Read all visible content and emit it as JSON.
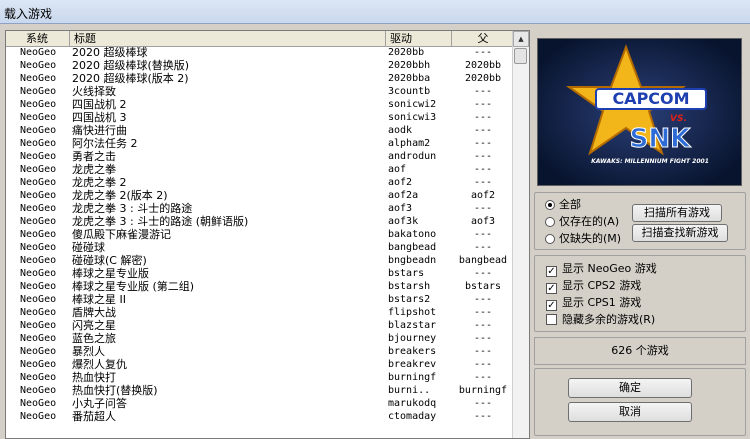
{
  "window": {
    "title": "载入游戏"
  },
  "list": {
    "columns": {
      "system": "系统",
      "title": "标题",
      "driver": "驱动",
      "parent": "父"
    },
    "rows": [
      {
        "system": "NeoGeo",
        "title": "2020 超级棒球",
        "driver": "2020bb",
        "parent": "---"
      },
      {
        "system": "NeoGeo",
        "title": "2020 超级棒球(替换版)",
        "driver": "2020bbh",
        "parent": "2020bb"
      },
      {
        "system": "NeoGeo",
        "title": "2020 超级棒球(版本 2)",
        "driver": "2020bba",
        "parent": "2020bb"
      },
      {
        "system": "NeoGeo",
        "title": "火线择致",
        "driver": "3countb",
        "parent": "---"
      },
      {
        "system": "NeoGeo",
        "title": "四国战机 2",
        "driver": "sonicwi2",
        "parent": "---"
      },
      {
        "system": "NeoGeo",
        "title": "四国战机 3",
        "driver": "sonicwi3",
        "parent": "---"
      },
      {
        "system": "NeoGeo",
        "title": "痛快进行曲",
        "driver": "aodk",
        "parent": "---"
      },
      {
        "system": "NeoGeo",
        "title": "阿尔法任务 2",
        "driver": "alpham2",
        "parent": "---"
      },
      {
        "system": "NeoGeo",
        "title": "勇者之击",
        "driver": "androdun",
        "parent": "---"
      },
      {
        "system": "NeoGeo",
        "title": "龙虎之拳",
        "driver": "aof",
        "parent": "---"
      },
      {
        "system": "NeoGeo",
        "title": "龙虎之拳 2",
        "driver": "aof2",
        "parent": "---"
      },
      {
        "system": "NeoGeo",
        "title": "龙虎之拳 2(版本 2)",
        "driver": "aof2a",
        "parent": "aof2"
      },
      {
        "system": "NeoGeo",
        "title": "龙虎之拳 3 : 斗士的路途",
        "driver": "aof3",
        "parent": "---"
      },
      {
        "system": "NeoGeo",
        "title": "龙虎之拳 3 : 斗士的路途 (朝鲜语版)",
        "driver": "aof3k",
        "parent": "aof3"
      },
      {
        "system": "NeoGeo",
        "title": "傻瓜殿下麻雀漫游记",
        "driver": "bakatono",
        "parent": "---"
      },
      {
        "system": "NeoGeo",
        "title": "碰碰球",
        "driver": "bangbead",
        "parent": "---"
      },
      {
        "system": "NeoGeo",
        "title": "碰碰球(C 解密)",
        "driver": "bngbeadn",
        "parent": "bangbead"
      },
      {
        "system": "NeoGeo",
        "title": "棒球之星专业版",
        "driver": "bstars",
        "parent": "---"
      },
      {
        "system": "NeoGeo",
        "title": "棒球之星专业版 (第二组)",
        "driver": "bstarsh",
        "parent": "bstars"
      },
      {
        "system": "NeoGeo",
        "title": "棒球之星 II",
        "driver": "bstars2",
        "parent": "---"
      },
      {
        "system": "NeoGeo",
        "title": "盾牌大战",
        "driver": "flipshot",
        "parent": "---"
      },
      {
        "system": "NeoGeo",
        "title": "闪亮之星",
        "driver": "blazstar",
        "parent": "---"
      },
      {
        "system": "NeoGeo",
        "title": "蓝色之旅",
        "driver": "bjourney",
        "parent": "---"
      },
      {
        "system": "NeoGeo",
        "title": "暴烈人",
        "driver": "breakers",
        "parent": "---"
      },
      {
        "system": "NeoGeo",
        "title": "爆烈人复仇",
        "driver": "breakrev",
        "parent": "---"
      },
      {
        "system": "NeoGeo",
        "title": "热血快打",
        "driver": "burningf",
        "parent": "---"
      },
      {
        "system": "NeoGeo",
        "title": "热血快打(替换版)",
        "driver": "burni..",
        "parent": "burningf"
      },
      {
        "system": "NeoGeo",
        "title": "小丸子问答",
        "driver": "marukodq",
        "parent": "---"
      },
      {
        "system": "NeoGeo",
        "title": "番茄超人",
        "driver": "ctomaday",
        "parent": "---"
      }
    ]
  },
  "preview": {
    "logo_top": "CAPCOM",
    "logo_vs": "VS.",
    "logo_bottom": "SNK",
    "logo_sub": "KAWAKS: MILLENNIUM FIGHT 2001"
  },
  "filter": {
    "options": [
      {
        "label": "全部",
        "selected": true
      },
      {
        "label": "仅存在的(A)",
        "selected": false
      },
      {
        "label": "仅缺失的(M)",
        "selected": false
      }
    ],
    "scan_all_label": "扫描所有游戏",
    "scan_new_label": "扫描查找新游戏"
  },
  "display": {
    "options": [
      {
        "label": "显示 NeoGeo 游戏",
        "checked": true
      },
      {
        "label": "显示 CPS2 游戏",
        "checked": true
      },
      {
        "label": "显示 CPS1 游戏",
        "checked": true
      },
      {
        "label": "隐藏多余的游戏(R)",
        "checked": false
      }
    ]
  },
  "status": {
    "count_text": "626 个游戏"
  },
  "actions": {
    "ok_label": "确定",
    "cancel_label": "取消"
  }
}
